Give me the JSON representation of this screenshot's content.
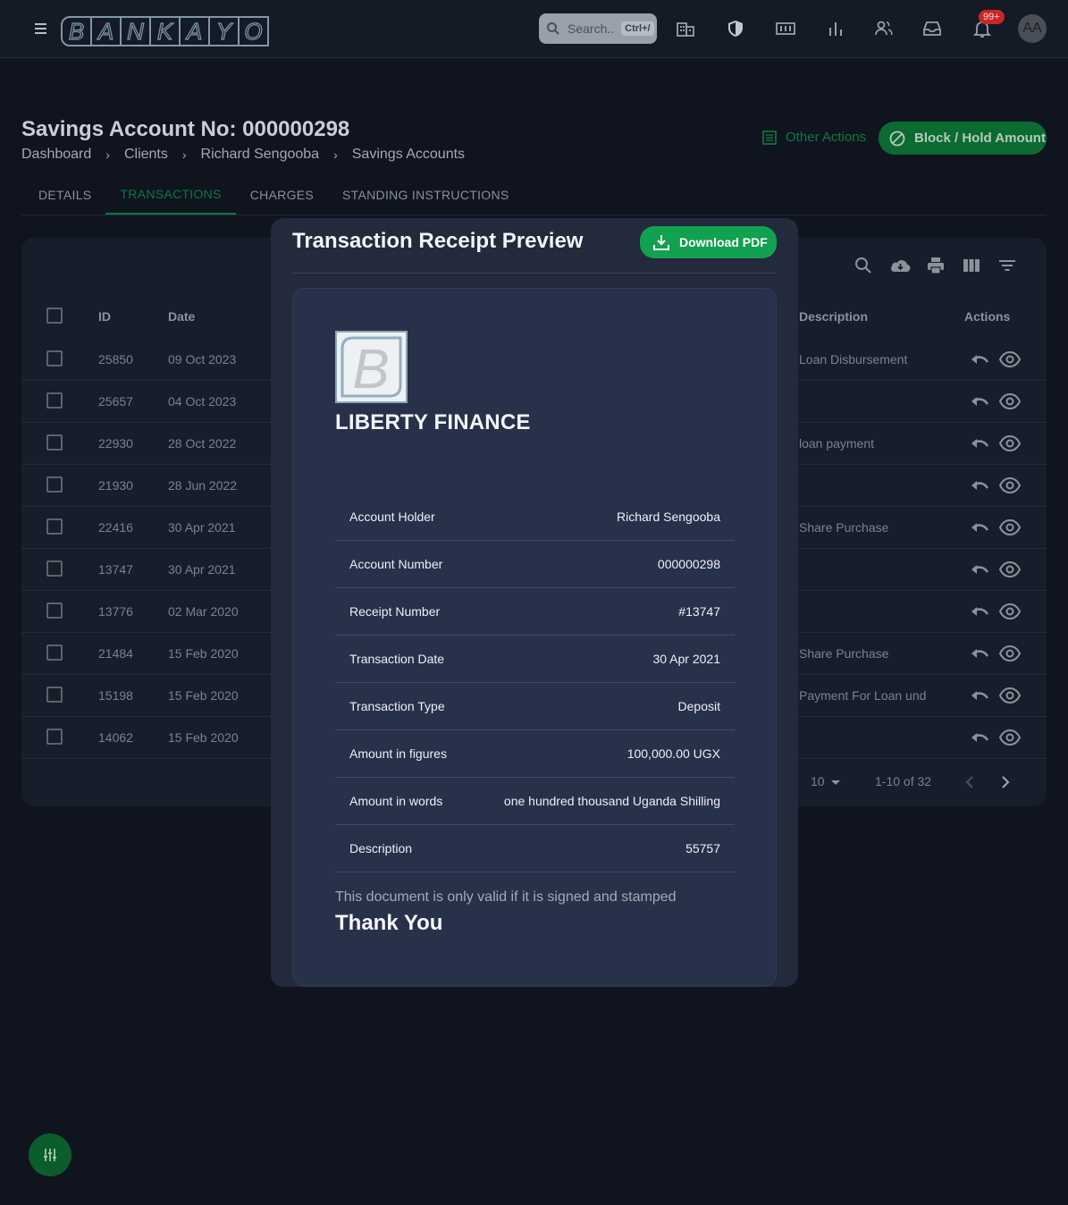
{
  "topbar": {
    "logo_letters": [
      "B",
      "A",
      "N",
      "K",
      "A",
      "Y",
      "O"
    ],
    "search": {
      "placeholder": "Search..",
      "shortcut": "Ctrl+/"
    },
    "notification_badge": "99+",
    "avatar_initials": "AA",
    "icons": [
      "menu-icon",
      "building-icon",
      "shield-icon",
      "money-icon",
      "chart-icon",
      "users-icon",
      "inbox-icon",
      "bell-icon"
    ]
  },
  "page": {
    "title": "Savings Account No: 000000298",
    "breadcrumb": [
      "Dashboard",
      "Clients",
      "Richard Sengooba",
      "Savings Accounts"
    ],
    "other_actions_label": "Other Actions",
    "block_button_label": "Block / Hold Amount",
    "tabs": [
      "DETAILS",
      "TRANSACTIONS",
      "CHARGES",
      "STANDING INSTRUCTIONS"
    ],
    "active_tab": "TRANSACTIONS"
  },
  "table": {
    "headers": {
      "id": "ID",
      "date": "Date",
      "description": "Description",
      "actions": "Actions"
    },
    "rows": [
      {
        "id": "25850",
        "date": "09 Oct 2023",
        "description": "Loan Disbursement"
      },
      {
        "id": "25657",
        "date": "04 Oct 2023",
        "description": ""
      },
      {
        "id": "22930",
        "date": "28 Oct 2022",
        "description": "loan payment"
      },
      {
        "id": "21930",
        "date": "28 Jun 2022",
        "description": ""
      },
      {
        "id": "22416",
        "date": "30 Apr 2021",
        "description": "Share Purchase"
      },
      {
        "id": "13747",
        "date": "30 Apr 2021",
        "description": ""
      },
      {
        "id": "13776",
        "date": "02 Mar 2020",
        "description": ""
      },
      {
        "id": "21484",
        "date": "15 Feb 2020",
        "description": "Share Purchase"
      },
      {
        "id": "15198",
        "date": "15 Feb 2020",
        "description": "Payment For Loan und"
      },
      {
        "id": "14062",
        "date": "15 Feb 2020",
        "description": ""
      }
    ],
    "rows_per_page": "10",
    "page_range": "1-10 of 32"
  },
  "modal": {
    "title": "Transaction Receipt Preview",
    "download_label": "Download PDF",
    "company_name": "LIBERTY FINANCE",
    "logo_letter": "B",
    "fields": [
      {
        "label": "Account Holder",
        "value": "Richard Sengooba"
      },
      {
        "label": "Account Number",
        "value": "000000298"
      },
      {
        "label": "Receipt Number",
        "value": "#13747"
      },
      {
        "label": "Transaction Date",
        "value": "30 Apr 2021"
      },
      {
        "label": "Transaction Type",
        "value": "Deposit"
      },
      {
        "label": "Amount in figures",
        "value": "100,000.00 UGX"
      },
      {
        "label": "Amount in words",
        "value": "one hundred thousand Uganda Shilling"
      },
      {
        "label": "Description",
        "value": "55757"
      }
    ],
    "note": "This document is only valid if it is signed and stamped",
    "thanks": "Thank You"
  },
  "colors": {
    "accent_green": "#12a150",
    "dark_green": "#0b6b31",
    "badge_red": "#c62828"
  }
}
